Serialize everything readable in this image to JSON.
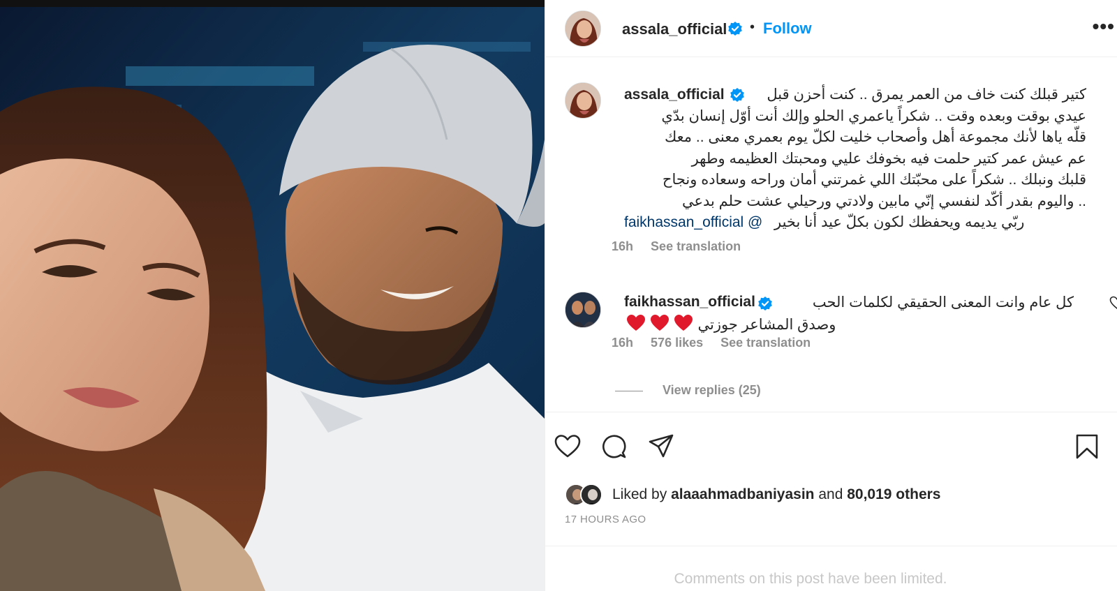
{
  "post": {
    "author": "assala_official",
    "follow_label": "Follow",
    "separator": "•",
    "more_label": "•••"
  },
  "caption": {
    "author": "assala_official",
    "lines": [
      "كتير قبلك كنت خاف من العمر يمرق .. كنت أحزن قبل",
      "عيدي بوقت وبعده وقت .. شكراً ياعمري الحلو وإلك أنت أوّل إنسان بدّي",
      "قلّه ياها لأنك مجموعة أهل وأصحاب خليت لكلّ يوم بعمري معنى .. معك",
      "عم عيش عمر كتير حلمت فيه بخوفك عليي ومحبتك العظيمه وطهر",
      "قلبك ونبلك .. شكراً على محبّتك اللي غمرتني أمان وراحه وسعاده ونجاح",
      ".. واليوم بقدر أكّد لنفسي إنّي مابين ولادتي ورحيلي عشت حلم بدعي"
    ],
    "mention": "faikhassan_official @",
    "last_line": "ربّي يديمه ويحفظك لكون بكلّ عيد أنا بخير",
    "time": "16h",
    "see_translation": "See translation"
  },
  "comment": {
    "author": "faikhassan_official",
    "line1": "كل عام وانت المعنى الحقيقي لكلمات الحب",
    "line2": "وصدق المشاعر جوزتي",
    "time": "16h",
    "likes": "576 likes",
    "see_translation": "See translation",
    "view_replies": "View replies (25)"
  },
  "likes": {
    "prefix": "Liked by",
    "user": "alaaahmadbaniyasin",
    "middle": "and",
    "others": "80,019 others"
  },
  "timestamp": "17 HOURS AGO",
  "comments_limited": "Comments on this post have been limited.",
  "colors": {
    "link": "#0095f6",
    "mention": "#00376b",
    "verified": "#0095f6",
    "heart": "#ed4956",
    "muted": "#8e8e8e"
  },
  "icons": [
    "verified-badge-icon",
    "more-options-icon",
    "heart-icon",
    "comment-icon",
    "share-icon",
    "bookmark-icon"
  ]
}
